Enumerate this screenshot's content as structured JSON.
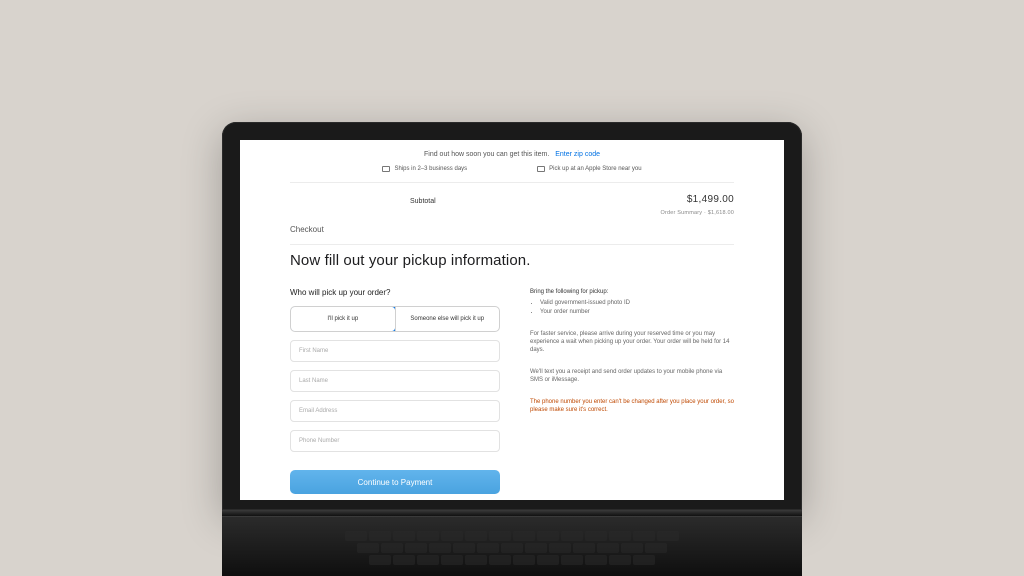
{
  "shipping": {
    "prompt": "Find out how soon you can get this item.",
    "zip_link": "Enter zip code",
    "option_ship": "Ships in 2–3 business days",
    "option_pickup": "Pick up at an Apple Store near you"
  },
  "summary": {
    "subtotal_label": "Subtotal",
    "subtotal_value": "$1,499.00",
    "secondary": "Order Summary  ·  $1,618.00"
  },
  "checkout_label": "Checkout",
  "page_title": "Now fill out your pickup information.",
  "who": {
    "label": "Who will pick up your order?",
    "tab_self": "I'll pick it up",
    "tab_other": "Someone else will pick it up"
  },
  "fields": {
    "first_name": "First Name",
    "last_name": "Last Name",
    "email": "Email Address",
    "phone": "Phone Number"
  },
  "info": {
    "bring_head": "Bring the following for pickup:",
    "bring_items": [
      "Valid government-issued photo ID",
      "Your order number"
    ],
    "contactless": "For faster service, please arrive during your reserved time or you may experience a wait when picking up your order. Your order will be held for 14 days.",
    "sms": "We'll text you a receipt and send order updates to your mobile phone via SMS or iMessage.",
    "phone_note": "The phone number you enter can't be changed after you place your order, so please make sure it's correct."
  },
  "continue_label": "Continue to Payment"
}
